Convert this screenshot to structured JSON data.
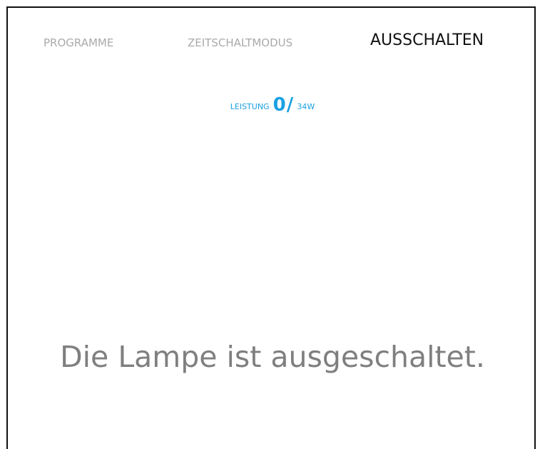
{
  "tabs": {
    "programme": "PROGRAMME",
    "zeitschaltmodus": "ZEITSCHALTMODUS",
    "ausschalten": "AUSSCHALTEN",
    "active": "ausschalten"
  },
  "power": {
    "label": "LEISTUNG",
    "current": "0",
    "separator": "/",
    "max": "34W"
  },
  "status_message": "Die Lampe ist ausgeschaltet.",
  "colors": {
    "accent": "#1ba1e2",
    "active_tab": "#111111",
    "inactive_tab": "#a9a9a9",
    "status_text": "#7f7f7f",
    "border": "#111111"
  }
}
